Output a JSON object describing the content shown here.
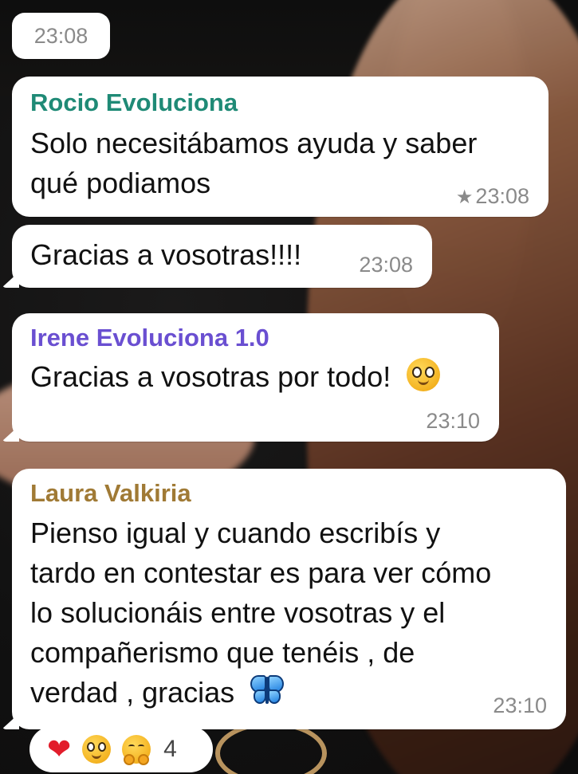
{
  "chip_time": "23:08",
  "messages": [
    {
      "sender": "Rocio Evoluciona",
      "sender_color": "#1f8a76",
      "lines": [
        "Solo necesitábamos ayuda y saber",
        "qué podiamos"
      ],
      "starred": true,
      "time": "23:08"
    },
    {
      "text": "Gracias a vosotras!!!!",
      "time": "23:08"
    },
    {
      "sender": "Irene Evoluciona 1.0",
      "sender_color": "#6a4fd1",
      "text": "Gracias a vosotras por todo!",
      "emoji": "pleading-face",
      "time": "23:10"
    },
    {
      "sender": "Laura Valkiria",
      "sender_color": "#a07a35",
      "lines": [
        "Pienso igual y cuando escribís y",
        "tardo en contestar es para ver cómo",
        "lo solucionáis entre vosotras y el",
        "compañerismo que tenéis , de",
        "verdad , gracias"
      ],
      "emoji": "butterfly",
      "time": "23:10"
    }
  ],
  "reactions": {
    "items": [
      "red-heart",
      "pleading-face",
      "hugging-face"
    ],
    "heart_glyph": "❤",
    "count": "4"
  }
}
